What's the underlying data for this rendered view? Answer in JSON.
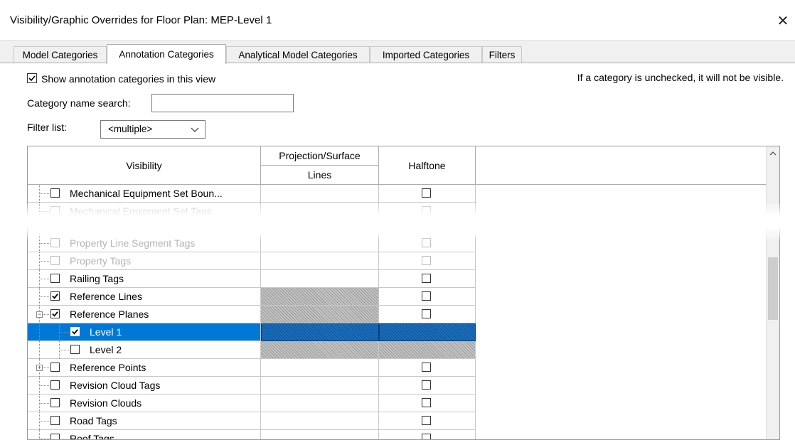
{
  "window": {
    "title": "Visibility/Graphic Overrides for Floor Plan: MEP-Level 1",
    "close_glyph": "✕"
  },
  "tabs": [
    {
      "label": "Model Categories",
      "active": false
    },
    {
      "label": "Annotation Categories",
      "active": true
    },
    {
      "label": "Analytical Model Categories",
      "active": false
    },
    {
      "label": "Imported Categories",
      "active": false
    },
    {
      "label": "Filters",
      "active": false
    }
  ],
  "panel": {
    "show_label": "Show annotation categories in this view",
    "show_checked": true,
    "hint": "If a category is unchecked, it will not be visible.",
    "search_label": "Category name search:",
    "search_value": "",
    "filter_label": "Filter list:",
    "filter_value": "<multiple>"
  },
  "grid": {
    "headers": {
      "visibility": "Visibility",
      "projection": "Projection/Surface",
      "lines": "Lines",
      "halftone": "Halftone"
    },
    "rows": [
      {
        "label": "Mechanical Equipment Set Boun...",
        "checked": false,
        "halftone": false,
        "level": 0,
        "expander": "",
        "faint": false,
        "lines_hatched": false,
        "halftone_hatched": false
      },
      {
        "label": "Mechanical Equipment Set Tags",
        "checked": false,
        "halftone": false,
        "level": 0,
        "expander": "",
        "faint": true,
        "lines_hatched": false,
        "halftone_hatched": false
      },
      {
        "label": "Property Line Segment Tags",
        "checked": false,
        "halftone": false,
        "level": 0,
        "expander": "",
        "faint": true,
        "lines_hatched": false,
        "halftone_hatched": false
      },
      {
        "label": "Property Tags",
        "checked": false,
        "halftone": false,
        "level": 0,
        "expander": "",
        "faint": true,
        "lines_hatched": false,
        "halftone_hatched": false
      },
      {
        "label": "Railing Tags",
        "checked": false,
        "halftone": false,
        "level": 0,
        "expander": "",
        "faint": false,
        "lines_hatched": false,
        "halftone_hatched": false
      },
      {
        "label": "Reference Lines",
        "checked": true,
        "halftone": false,
        "level": 0,
        "expander": "",
        "faint": false,
        "lines_hatched": true,
        "halftone_hatched": false
      },
      {
        "label": "Reference Planes",
        "checked": true,
        "halftone": false,
        "level": 0,
        "expander": "minus",
        "faint": false,
        "lines_hatched": true,
        "halftone_hatched": false
      },
      {
        "label": "Level 1",
        "checked": true,
        "halftone": null,
        "level": 1,
        "expander": "",
        "faint": false,
        "lines_hatched": true,
        "halftone_hatched": true,
        "selected": true
      },
      {
        "label": "Level 2",
        "checked": false,
        "halftone": null,
        "level": 1,
        "expander": "",
        "faint": false,
        "lines_hatched": true,
        "halftone_hatched": true
      },
      {
        "label": "Reference Points",
        "checked": false,
        "halftone": false,
        "level": 0,
        "expander": "plus",
        "faint": false,
        "lines_hatched": false,
        "halftone_hatched": false
      },
      {
        "label": "Revision Cloud Tags",
        "checked": false,
        "halftone": false,
        "level": 0,
        "expander": "",
        "faint": false,
        "lines_hatched": false,
        "halftone_hatched": false
      },
      {
        "label": "Revision Clouds",
        "checked": false,
        "halftone": false,
        "level": 0,
        "expander": "",
        "faint": false,
        "lines_hatched": false,
        "halftone_hatched": false
      },
      {
        "label": "Road Tags",
        "checked": false,
        "halftone": false,
        "level": 0,
        "expander": "",
        "faint": false,
        "lines_hatched": false,
        "halftone_hatched": false
      },
      {
        "label": "Roof Tags",
        "checked": false,
        "halftone": false,
        "level": 0,
        "expander": "",
        "faint": false,
        "lines_hatched": false,
        "halftone_hatched": false
      }
    ]
  },
  "colors": {
    "selection": "#0078d7",
    "hatch": "#c4c4c4",
    "tabbar": "#f0f0f0"
  }
}
